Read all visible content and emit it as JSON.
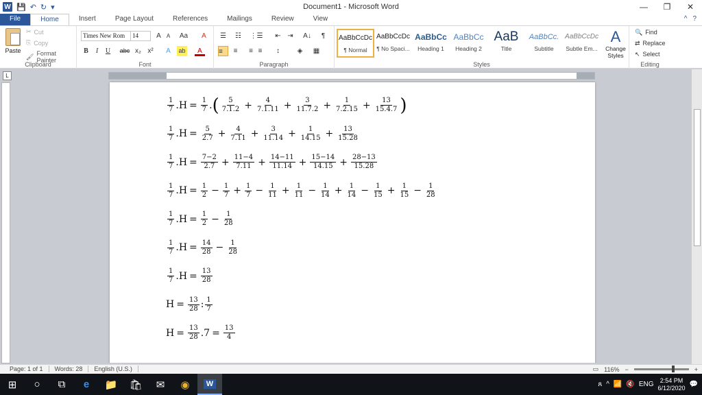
{
  "window": {
    "title": "Document1 - Microsoft Word",
    "minimize": "—",
    "restore": "❐",
    "close": "✕"
  },
  "qat": {
    "logo": "W",
    "save": "💾",
    "undo": "↶",
    "redo": "↻",
    "more": "▾"
  },
  "tabs": [
    "File",
    "Home",
    "Insert",
    "Page Layout",
    "References",
    "Mailings",
    "Review",
    "View"
  ],
  "tabs_right": {
    "help": "?",
    "collapse": "^"
  },
  "ribbon": {
    "clipboard": {
      "paste": "Paste",
      "cut": "Cut",
      "copy": "Copy",
      "format_painter": "Format Painter",
      "label": "Clipboard"
    },
    "font": {
      "name": "Times New Rom",
      "size": "14",
      "grow": "A",
      "shrink": "A",
      "case": "Aa",
      "clear": "A",
      "bold": "B",
      "italic": "I",
      "underline": "U",
      "strike": "abc",
      "sub": "x₂",
      "sup": "x²",
      "effects": "A",
      "highlight": "ab",
      "color": "A",
      "label": "Font"
    },
    "paragraph": {
      "bullets": "☰",
      "numbering": "☷",
      "multilevel": "⋮☰",
      "dec_indent": "⇤",
      "inc_indent": "⇥",
      "sort": "A↓",
      "pilcrow": "¶",
      "align_left": "≡",
      "center": "≡",
      "align_right": "≡",
      "justify": "≡",
      "spacing": "↕",
      "shading": "◈",
      "borders": "▦",
      "label": "Paragraph"
    },
    "styles": {
      "items": [
        {
          "preview": "AaBbCcDc",
          "name": "¶ Normal"
        },
        {
          "preview": "AaBbCcDc",
          "name": "¶ No Spaci..."
        },
        {
          "preview": "AaBbCc",
          "name": "Heading 1"
        },
        {
          "preview": "AaBbCc",
          "name": "Heading 2"
        },
        {
          "preview": "AaB",
          "name": "Title"
        },
        {
          "preview": "AaBbCc.",
          "name": "Subtitle"
        },
        {
          "preview": "AaBbCcDc",
          "name": "Subtle Em..."
        }
      ],
      "change": "Change Styles",
      "label": "Styles"
    },
    "editing": {
      "find": "Find",
      "replace": "Replace",
      "select": "Select",
      "label": "Editing"
    }
  },
  "ruler": {
    "tab_selector": "L"
  },
  "equations": [
    {
      "lhs_n": "1",
      "lhs_d": "7",
      "v": "H",
      "terms": [
        [
          "5",
          "7.1.2"
        ],
        [
          "4",
          "7.1.11"
        ],
        [
          "3",
          "11.7.2"
        ],
        [
          "1",
          "7.2.15"
        ],
        [
          "13",
          "15.4.7"
        ]
      ],
      "prefix_n": "1",
      "prefix_d": "7",
      "paren": true
    },
    {
      "lhs_n": "1",
      "lhs_d": "7",
      "v": "H",
      "terms": [
        [
          "5",
          "2.7"
        ],
        [
          "4",
          "7.11"
        ],
        [
          "3",
          "11.14"
        ],
        [
          "1",
          "14.15"
        ],
        [
          "13",
          "15.28"
        ]
      ]
    },
    {
      "lhs_n": "1",
      "lhs_d": "7",
      "v": "H",
      "terms": [
        [
          "7−2",
          "2.7"
        ],
        [
          "11−4",
          "7.11"
        ],
        [
          "14−11",
          "11.14"
        ],
        [
          "15−14",
          "14.15"
        ],
        [
          "28−13",
          "15.28"
        ]
      ]
    },
    {
      "lhs_n": "1",
      "lhs_d": "7",
      "v": "H",
      "alt": [
        [
          "1",
          "2"
        ],
        [
          "1",
          "7"
        ],
        [
          "1",
          "7"
        ],
        [
          "1",
          "11"
        ],
        [
          "1",
          "11"
        ],
        [
          "1",
          "14"
        ],
        [
          "1",
          "14"
        ],
        [
          "1",
          "15"
        ],
        [
          "1",
          "15"
        ],
        [
          "1",
          "28"
        ]
      ]
    },
    {
      "lhs_n": "1",
      "lhs_d": "7",
      "v": "H",
      "alt": [
        [
          "1",
          "2"
        ],
        [
          "1",
          "28"
        ]
      ]
    },
    {
      "lhs_n": "1",
      "lhs_d": "7",
      "v": "H",
      "alt": [
        [
          "14",
          "28"
        ],
        [
          "1",
          "28"
        ]
      ]
    },
    {
      "lhs_n": "1",
      "lhs_d": "7",
      "v": "H",
      "alt": [
        [
          "13",
          "28"
        ]
      ]
    },
    {
      "v": "H",
      "div": [
        [
          "13",
          "28"
        ],
        [
          "1",
          "7"
        ]
      ]
    },
    {
      "v": "H",
      "mul": [
        [
          "13",
          "28"
        ]
      ],
      "times": "7",
      "res": [
        "13",
        "4"
      ]
    }
  ],
  "status": {
    "page": "Page: 1 of 1",
    "words": "Words: 28",
    "lang": "English (U.S.)",
    "zoom": "116%",
    "zoom_minus": "−",
    "zoom_plus": "+"
  },
  "taskbar": {
    "start": "⊞",
    "search": "○",
    "taskview": "⧉",
    "edge": "e",
    "explorer": "📁",
    "store": "🛍",
    "mail": "✉",
    "chrome": "◉",
    "word": "W"
  },
  "tray": {
    "people": "ጸ",
    "lang": "ENG",
    "time": "2:54 PM",
    "date": "6/12/2020",
    "notify": "💬",
    "volume": "🔇",
    "wifi": "📶",
    "up": "^"
  }
}
